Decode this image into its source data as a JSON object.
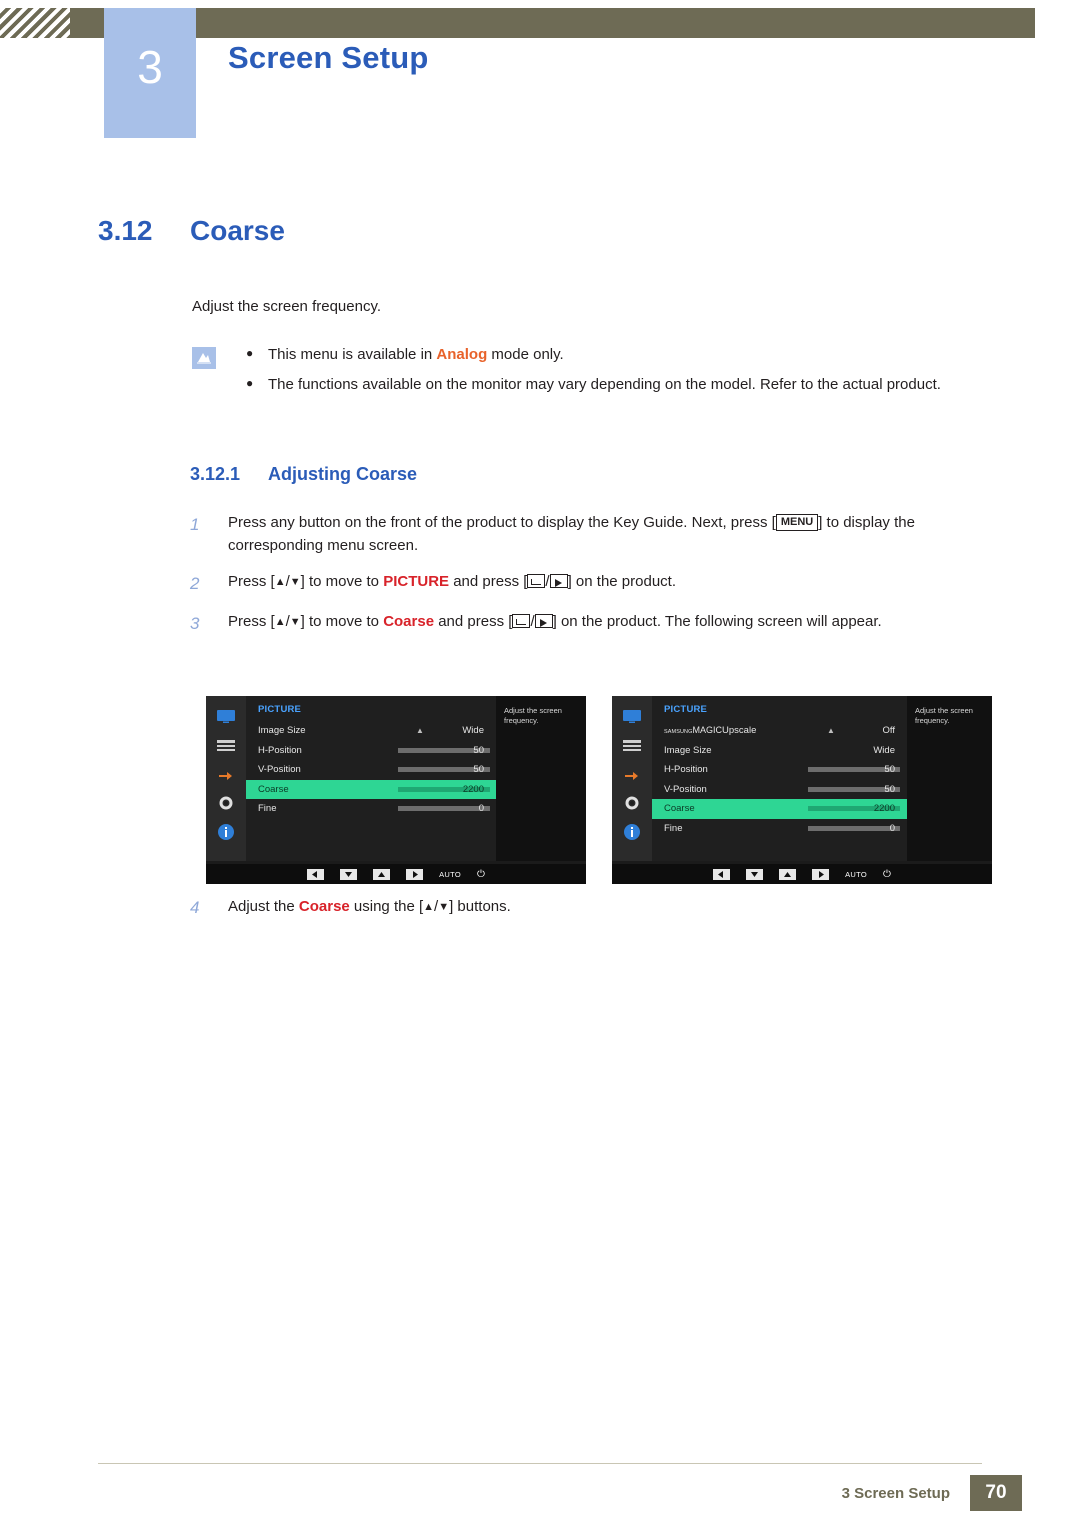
{
  "header": {
    "chapter_number": "3",
    "title": "Screen Setup"
  },
  "section": {
    "number": "3.12",
    "title": "Coarse"
  },
  "intro": "Adjust the screen frequency.",
  "notes": [
    {
      "prefix": "This menu is available in ",
      "highlight": "Analog",
      "suffix": " mode only."
    },
    {
      "prefix": "The functions available on the monitor may vary depending on the model. Refer to the actual product.",
      "highlight": "",
      "suffix": ""
    }
  ],
  "subsection": {
    "number": "3.12.1",
    "title": "Adjusting Coarse"
  },
  "steps": [
    {
      "num": "1",
      "text_a": "Press any button on the front of the product to display the Key Guide. Next, press [",
      "key": "MENU",
      "text_b": "] to display the corresponding menu screen."
    },
    {
      "num": "2",
      "text_a": "Press [",
      "text_b": "] to move to ",
      "target": "PICTURE",
      "text_c": " and press [",
      "text_d": "] on the product."
    },
    {
      "num": "3",
      "text_a": "Press [",
      "text_b": "] to move to ",
      "target": "Coarse",
      "text_c": " and press [",
      "text_d": "] on the product. The following screen will appear."
    }
  ],
  "step4": {
    "num": "4",
    "text_a": "Adjust the ",
    "target": "Coarse",
    "text_b": " using the [",
    "text_c": "] buttons."
  },
  "osd": {
    "menu_title": "PICTURE",
    "help_text": "Adjust the screen frequency.",
    "auto_label": "AUTO",
    "model_a": {
      "rows": [
        {
          "label": "Image Size",
          "value": "Wide",
          "bar": false
        },
        {
          "label": "H-Position",
          "value": "50",
          "bar": true,
          "fill": 50
        },
        {
          "label": "V-Position",
          "value": "50",
          "bar": true,
          "fill": 50
        },
        {
          "label": "Coarse",
          "value": "2200",
          "bar": true,
          "fill": 78,
          "highlight": true
        },
        {
          "label": "Fine",
          "value": "0",
          "bar": true,
          "fill": 0
        }
      ]
    },
    "model_b": {
      "magic_brand": "SAMSUNG",
      "magic_label": "MAGIC",
      "rows": [
        {
          "label": "Upscale",
          "value": "Off",
          "bar": false,
          "magic": true
        },
        {
          "label": "Image Size",
          "value": "Wide",
          "bar": false
        },
        {
          "label": "H-Position",
          "value": "50",
          "bar": true,
          "fill": 50
        },
        {
          "label": "V-Position",
          "value": "50",
          "bar": true,
          "fill": 50
        },
        {
          "label": "Coarse",
          "value": "2200",
          "bar": true,
          "fill": 78,
          "highlight": true
        },
        {
          "label": "Fine",
          "value": "0",
          "bar": true,
          "fill": 0
        }
      ]
    }
  },
  "footer": {
    "text": "3 Screen Setup",
    "page": "70"
  }
}
